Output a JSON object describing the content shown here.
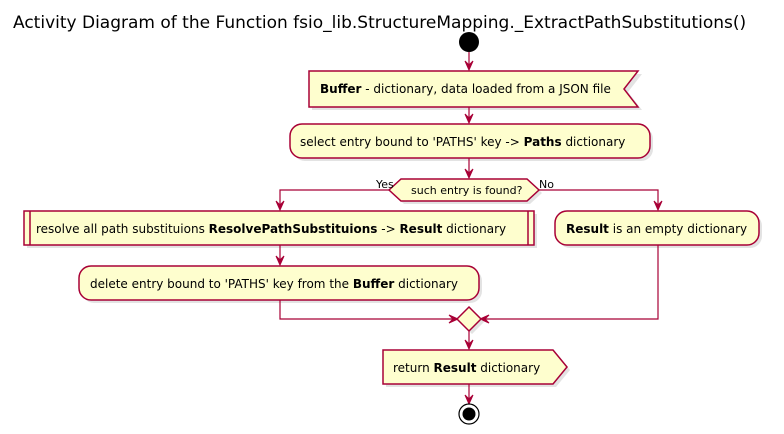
{
  "title": "Activity Diagram of the Function fsio_lib.StructureMapping._ExtractPathSubstitutions()",
  "nodes": {
    "buffer": {
      "bold": "Buffer",
      "text": " - dictionary, data loaded from a JSON file"
    },
    "select": {
      "text": "select entry bound to 'PATHS' key -> ",
      "bold": "Paths",
      "text2": " dictionary"
    },
    "decision": {
      "text": "such entry is found?",
      "yes": "Yes",
      "no": "No"
    },
    "resolve": {
      "text": "resolve all path substituions ",
      "bold": "ResolvePathSubstituions",
      "text2": " -> ",
      "bold2": "Result",
      "text3": " dictionary"
    },
    "delete": {
      "text": "delete entry bound to 'PATHS' key from the ",
      "bold": "Buffer",
      "text2": " dictionary"
    },
    "empty": {
      "bold": "Result",
      "text": " is an empty dictionary"
    },
    "return": {
      "text": "return ",
      "bold": "Result",
      "text2": " dictionary"
    }
  },
  "colors": {
    "node_fill": "#FEFECE",
    "border": "#A80036",
    "start_stop": "#000000"
  }
}
